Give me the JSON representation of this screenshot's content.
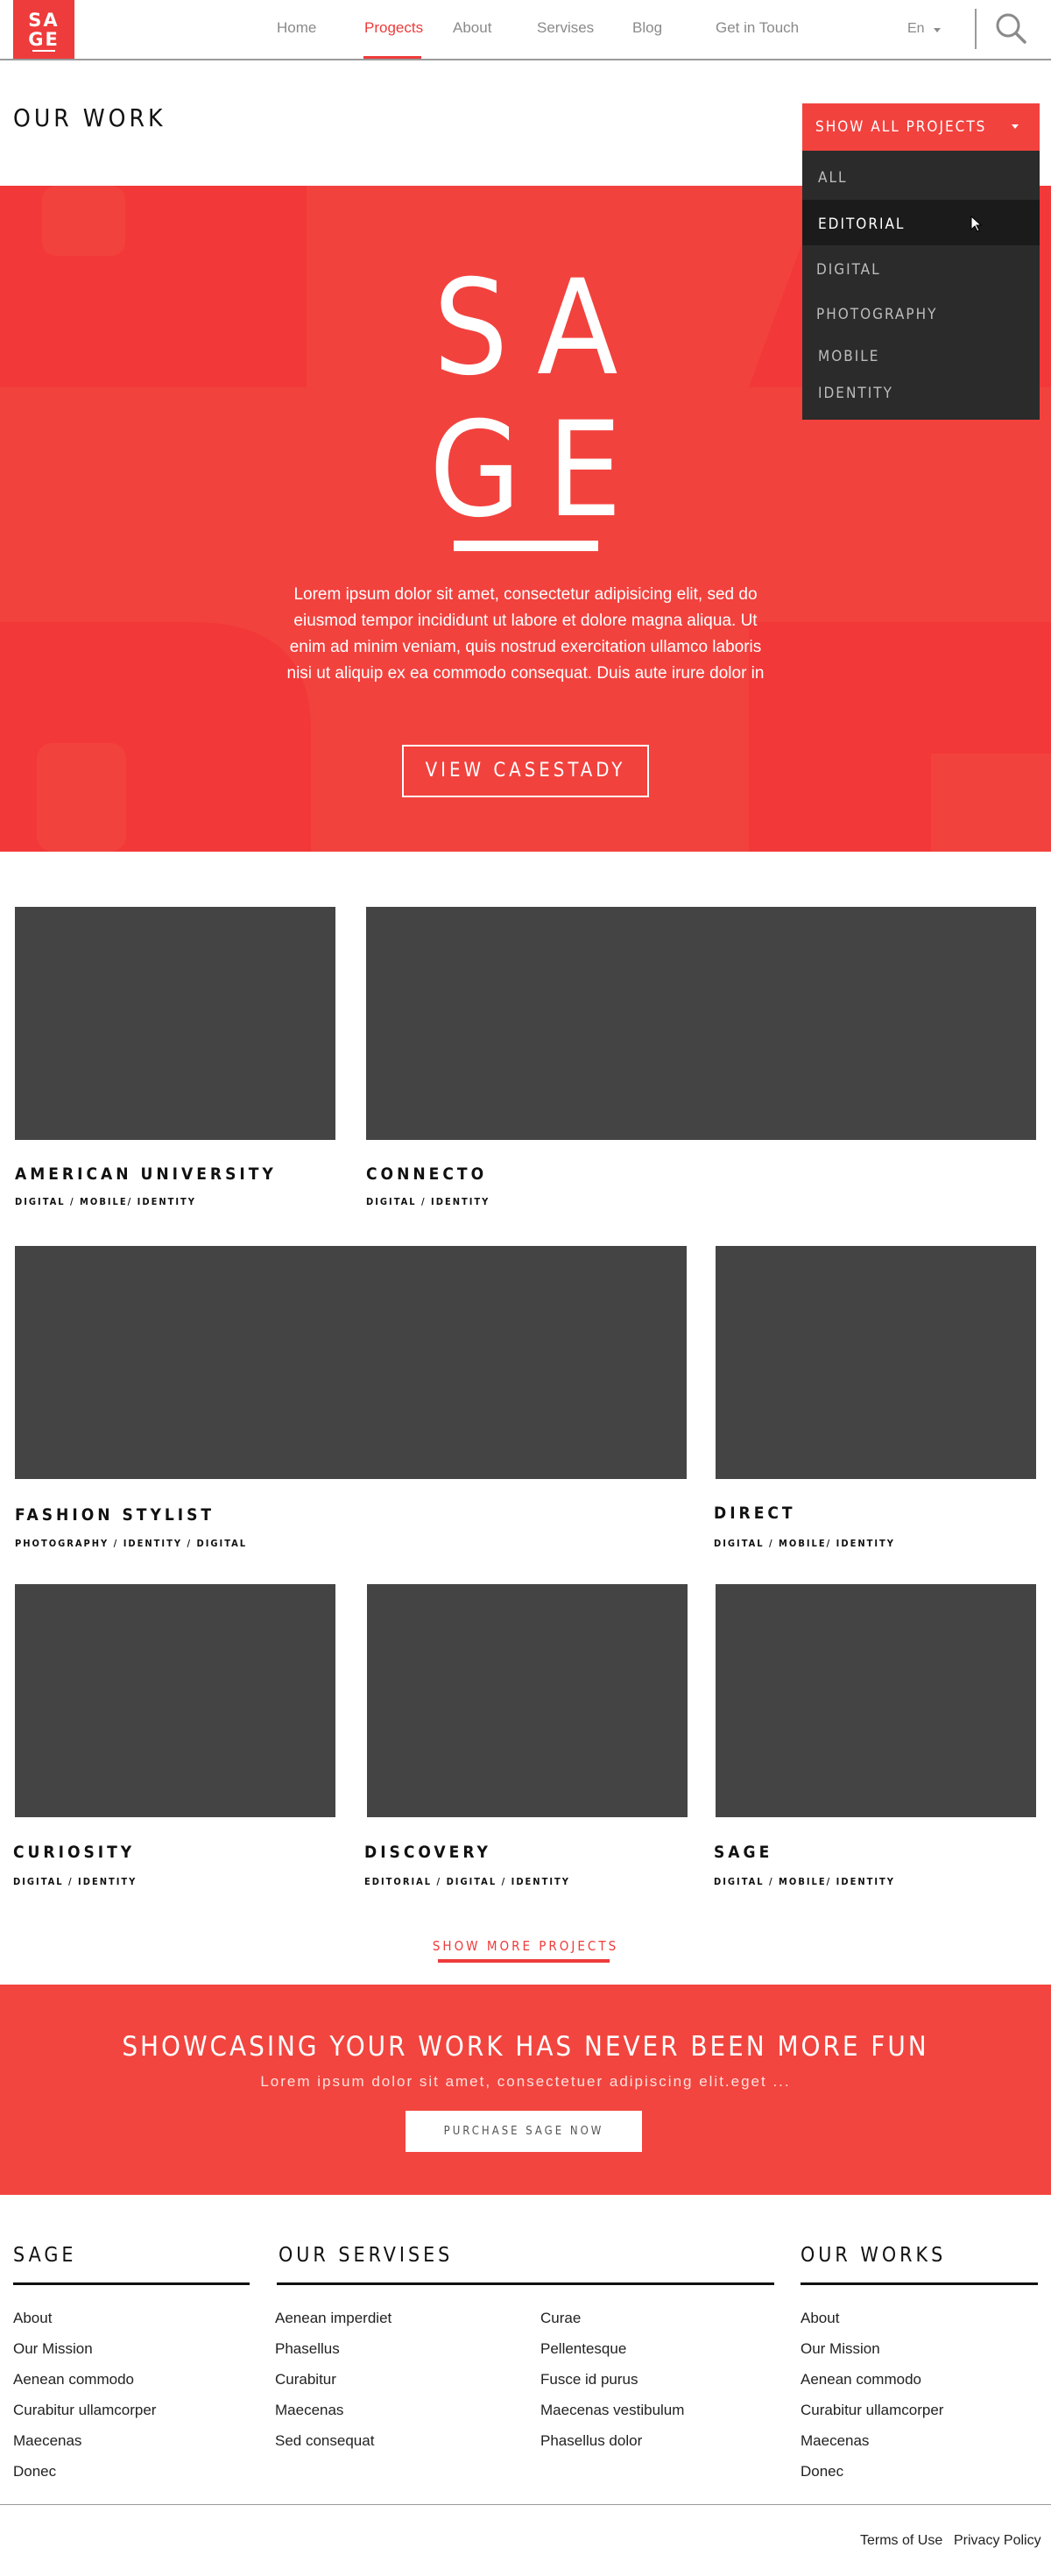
{
  "nav": {
    "logo_line1": "SA",
    "logo_line2": "GE",
    "items": [
      {
        "label": "Home"
      },
      {
        "label": "Progects"
      },
      {
        "label": "About"
      },
      {
        "label": "Servises"
      },
      {
        "label": "Blog"
      },
      {
        "label": "Get in Touch"
      }
    ],
    "active_item": "Progects",
    "language": "En",
    "search_icon": "search-icon"
  },
  "page": {
    "title": "OUR WORK"
  },
  "filter": {
    "toggle_label": "SHOW ALL PROJECTS",
    "options": [
      {
        "label": "ALL"
      },
      {
        "label": "EDITORIAL"
      },
      {
        "label": "DIGITAL"
      },
      {
        "label": "PHOTOGRAPHY"
      },
      {
        "label": "MOBILE"
      },
      {
        "label": "IDENTITY"
      }
    ],
    "hovered_option": "EDITORIAL"
  },
  "hero": {
    "title_line1": "SA",
    "title_line2": "GE",
    "text": "Lorem ipsum dolor sit amet, consectetur adipisicing elit, sed do eiusmod tempor incididunt ut labore et dolore magna aliqua. Ut enim ad minim veniam, quis nostrud exercitation ullamco laboris nisi ut aliquip ex ea commodo consequat. Duis aute irure dolor in",
    "button_label": "VIEW  CASESTADY",
    "background_color": "#f2423e"
  },
  "projects": [
    {
      "title": "AMERICAN UNIVERSITY",
      "tags": "DIGITAL / MOBILE/ IDENTITY"
    },
    {
      "title": "CONNECTO",
      "tags": "DIGITAL / IDENTITY"
    },
    {
      "title": "FASHION STYLIST",
      "tags": "PHOTOGRAPHY / IDENTITY / DIGITAL"
    },
    {
      "title": "DIRECT",
      "tags": "DIGITAL / MOBILE/ IDENTITY"
    },
    {
      "title": "CURIOSITY",
      "tags": "DIGITAL / IDENTITY"
    },
    {
      "title": "DISCOVERY",
      "tags": "EDITORIAL / DIGITAL / IDENTITY"
    },
    {
      "title": "SAGE",
      "tags": "DIGITAL / MOBILE/ IDENTITY"
    }
  ],
  "show_more_label": "SHOW MORE PROJECTS",
  "cta": {
    "title": "SHOWCASING YOUR WORK HAS NEVER BEEN MORE FUN",
    "subtitle": "Lorem ipsum dolor sit amet, consectetuer adipiscing elit.eget ...",
    "button_label": "PURCHASE SAGE NOW"
  },
  "footer": {
    "sage": {
      "heading": "SAGE",
      "links": [
        "About",
        "Our Mission",
        "Aenean commodo",
        "Curabitur ullamcorper",
        "Maecenas",
        "Donec"
      ]
    },
    "services": {
      "heading": "OUR SERVISES",
      "col1": [
        "Aenean imperdiet",
        "Phasellus",
        "Curabitur",
        "Maecenas",
        "Sed consequat"
      ],
      "col2": [
        "Curae",
        "Pellentesque",
        "Fusce id purus",
        "Maecenas vestibulum",
        "Phasellus dolor"
      ]
    },
    "works": {
      "heading": "OUR WORKS",
      "links": [
        "About",
        "Our Mission",
        "Aenean commodo",
        "Curabitur ullamcorper",
        "Maecenas",
        "Donec"
      ]
    },
    "terms_label": "Terms of Use",
    "privacy_label": "Privacy Policy"
  },
  "colors": {
    "accent": "#ee3b3b",
    "dark_menu": "#2b2b2b",
    "thumbnail": "#444444"
  }
}
